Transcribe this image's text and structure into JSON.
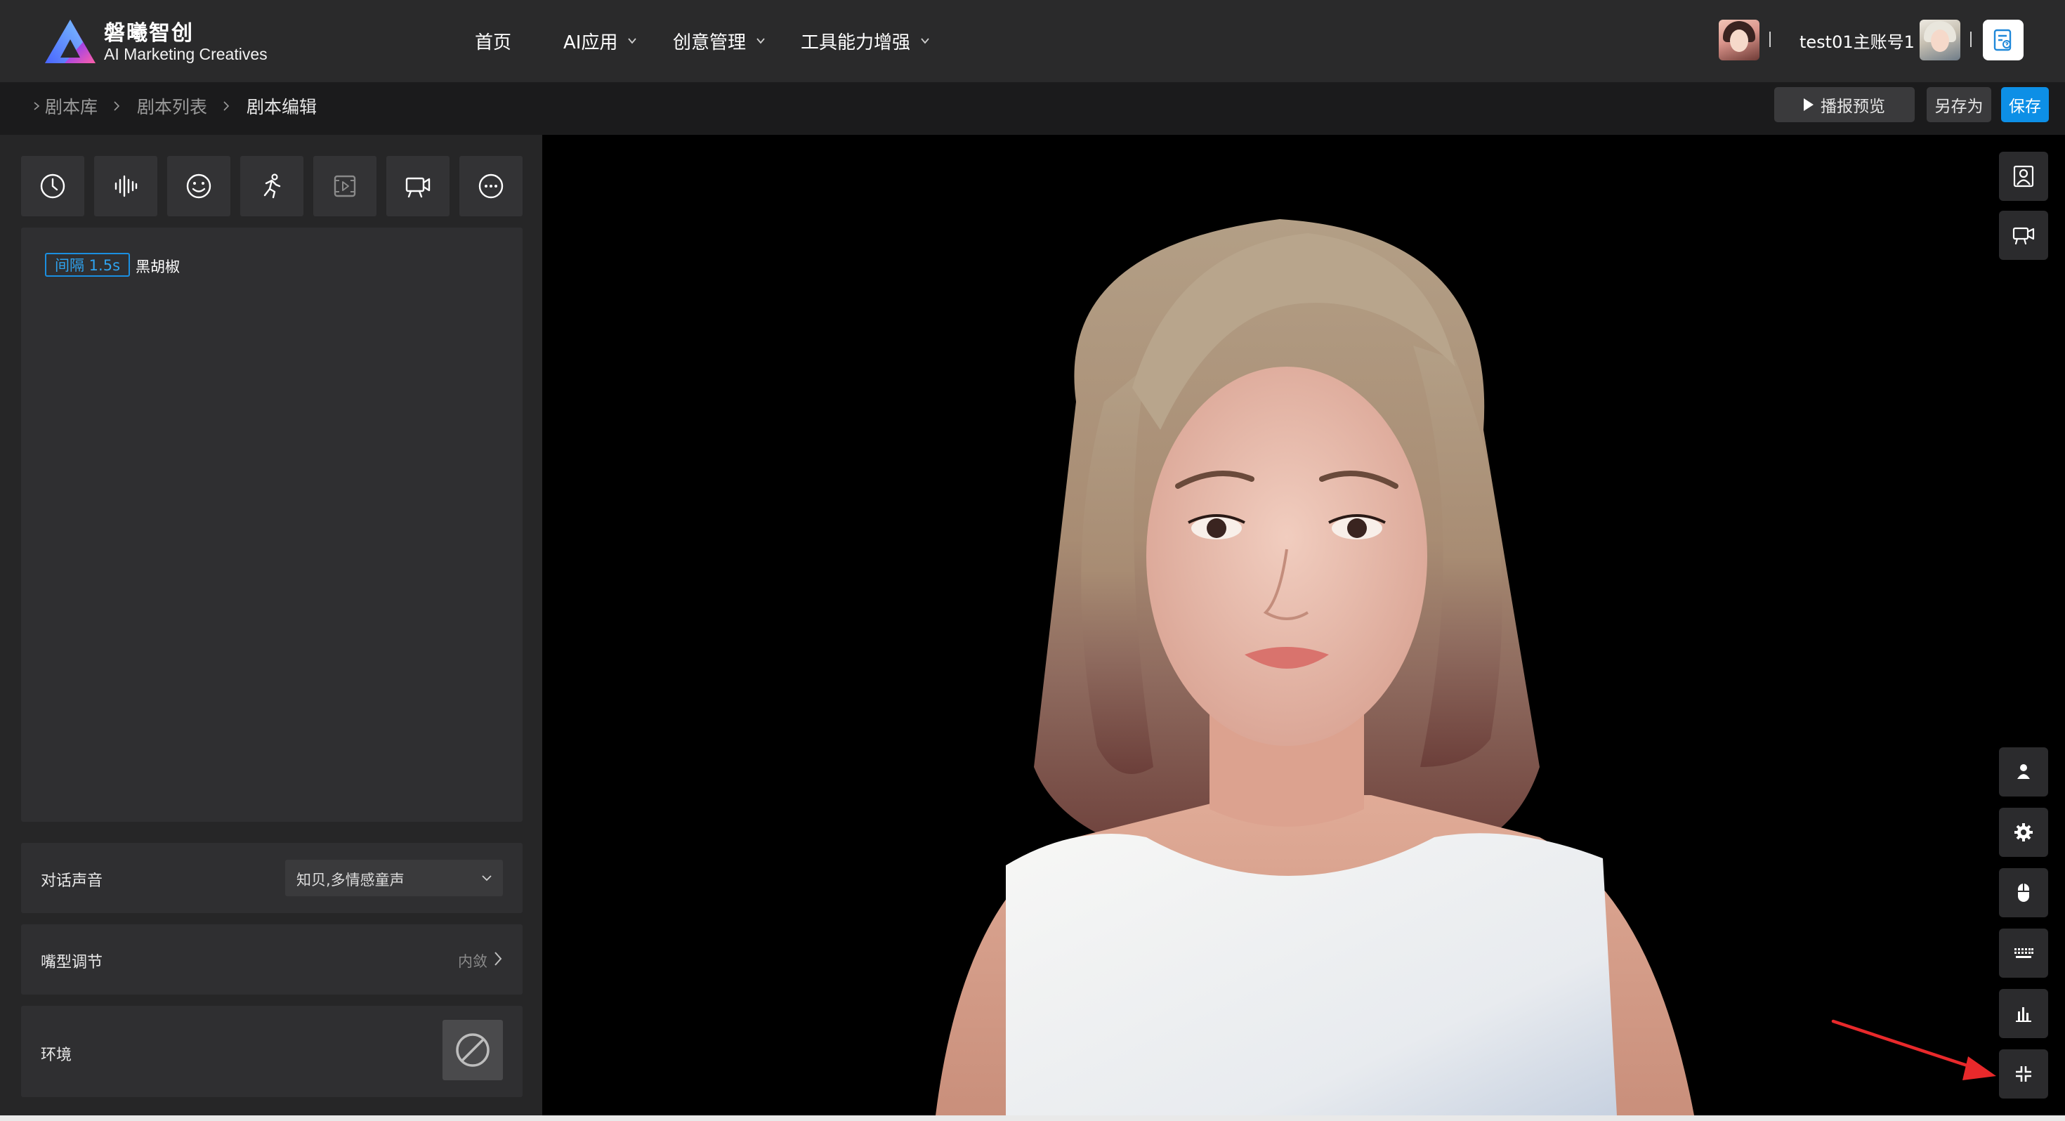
{
  "brand": {
    "name_cn": "磐曦智创",
    "name_en": "AI Marketing Creatives",
    "logo_icon": "triangle-gradient-logo-icon"
  },
  "nav": {
    "home": "首页",
    "ai_apps": "AI应用",
    "creative_mgmt": "创意管理",
    "tools_enhance": "工具能力增强"
  },
  "user": {
    "name": "test01主账号1"
  },
  "breadcrumb": {
    "items": [
      "剧本库",
      "剧本列表",
      "剧本编辑"
    ]
  },
  "actions": {
    "preview": "播报预览",
    "save_as": "另存为",
    "save": "保存"
  },
  "toolbar": {
    "tools": [
      "clock-icon",
      "waveform-icon",
      "smiley-icon",
      "running-person-icon",
      "video-play-icon",
      "camera-icon",
      "more-icon"
    ]
  },
  "script": {
    "interval_tag": "间隔 1.5s",
    "text": "黑胡椒"
  },
  "settings": {
    "voice_label": "对话声音",
    "voice_value": "知贝,多情感童声",
    "mouth_label": "嘴型调节",
    "mouth_value": "内敛",
    "env_label": "环境"
  },
  "stage": {
    "top_buttons": [
      "portrait-icon",
      "camera-icon"
    ],
    "bottom_buttons": [
      "person-icon",
      "gear-icon",
      "mouse-icon",
      "keyboard-icon",
      "bar-chart-icon",
      "exit-fullscreen-icon"
    ]
  },
  "colors": {
    "accent_blue": "#0d8fe6",
    "tag_blue": "#2fa3ef",
    "annotation_red": "#e8292b",
    "topbar_bg": "#2a2a2b",
    "panel_bg": "#262627",
    "stage_bg": "#000000"
  }
}
